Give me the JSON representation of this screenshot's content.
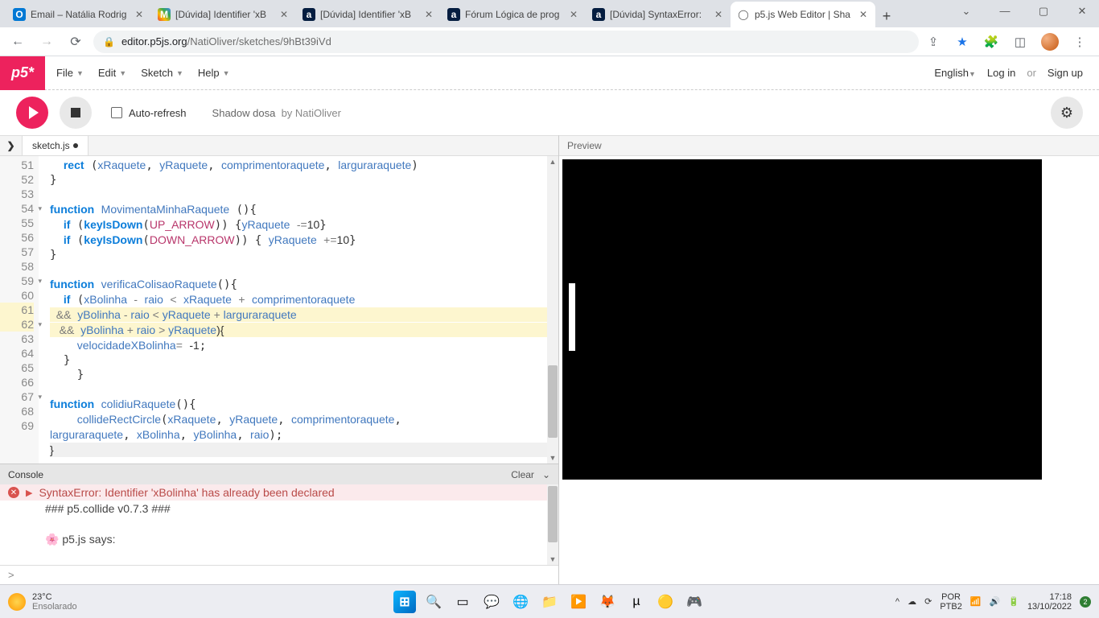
{
  "chrome": {
    "tabs": [
      {
        "title": "Email – Natália Rodrig",
        "fav": "O"
      },
      {
        "title": "[Dúvida] Identifier 'xB",
        "fav": "M"
      },
      {
        "title": "[Dúvida] Identifier 'xB",
        "fav": "a"
      },
      {
        "title": "Fórum Lógica de prog",
        "fav": "a"
      },
      {
        "title": "[Dúvida] SyntaxError:",
        "fav": "a"
      },
      {
        "title": "p5.js Web Editor | Sha",
        "fav": "◯"
      }
    ],
    "url_host": "editor.p5js.org",
    "url_path": "/NatiOliver/sketches/9hBt39iVd"
  },
  "p5": {
    "logo": "p5*",
    "menu": {
      "file": "File",
      "edit": "Edit",
      "sketch": "Sketch",
      "help": "Help"
    },
    "right": {
      "lang": "English",
      "login": "Log in",
      "or": "or",
      "signup": "Sign up"
    },
    "toolbar": {
      "auto": "Auto-refresh",
      "sketch_name": "Shadow dosa",
      "by": "by NatiOliver"
    },
    "file_tab": "sketch.js",
    "preview_label": "Preview",
    "console": {
      "title": "Console",
      "clear": "Clear",
      "error": "SyntaxError: Identifier 'xBolinha' has already been declared",
      "line2": "### p5.collide v0.7.3 ###",
      "line3": "🌸 p5.js says:",
      "prompt": ">"
    },
    "gutter": [
      "51",
      "52",
      "53",
      "54",
      "55",
      "56",
      "57",
      "58",
      "59",
      "60",
      "61",
      "62",
      "63",
      "64",
      "65",
      "66",
      "67",
      "68",
      " ",
      "69"
    ]
  },
  "code": {
    "l51a": "rect",
    "l51b": "xRaquete",
    "l51c": "yRaquete",
    "l51d": "comprimentoraquete",
    "l51e": "larguraraquete",
    "l54a": "function",
    "l54b": "MovimentaMinhaRaquete",
    "l55a": "if",
    "l55b": "keyIsDown",
    "l55c": "UP_ARROW",
    "l55d": "yRaquete",
    "l55e": "-=",
    "l55f": "10",
    "l56a": "if",
    "l56b": "keyIsDown",
    "l56c": "DOWN_ARROW",
    "l56d": "yRaquete",
    "l56e": "+=",
    "l56f": "10",
    "l59a": "function",
    "l59b": "verificaColisaoRaquete",
    "l60a": "if",
    "l60b": "xBolinha",
    "l60c": "raio",
    "l60d": "xRaquete",
    "l60e": "comprimentoraquete",
    "l61a": "&&",
    "l61b": "yBolinha",
    "l61c": "raio",
    "l61d": "yRaquete",
    "l61e": "larguraraquete",
    "l62a": "&&",
    "l62b": "yBolinha",
    "l62c": "raio",
    "l62d": "yRaquete",
    "l63a": "velocidadeXBolinha",
    "l63b": "-1",
    "l67a": "function",
    "l67b": "colidiuRaquete",
    "l68a": "collideRectCircle",
    "l68b": "xRaquete",
    "l68c": "yRaquete",
    "l68d": "comprimentoraquete",
    "l68e": "larguraraquete",
    "l68f": "xBolinha",
    "l68g": "yBolinha",
    "l68h": "raio"
  },
  "taskbar": {
    "temp": "23°C",
    "weather": "Ensolarado",
    "lang1": "POR",
    "lang2": "PTB2",
    "time": "17:18",
    "date": "13/10/2022",
    "badge": "2"
  }
}
